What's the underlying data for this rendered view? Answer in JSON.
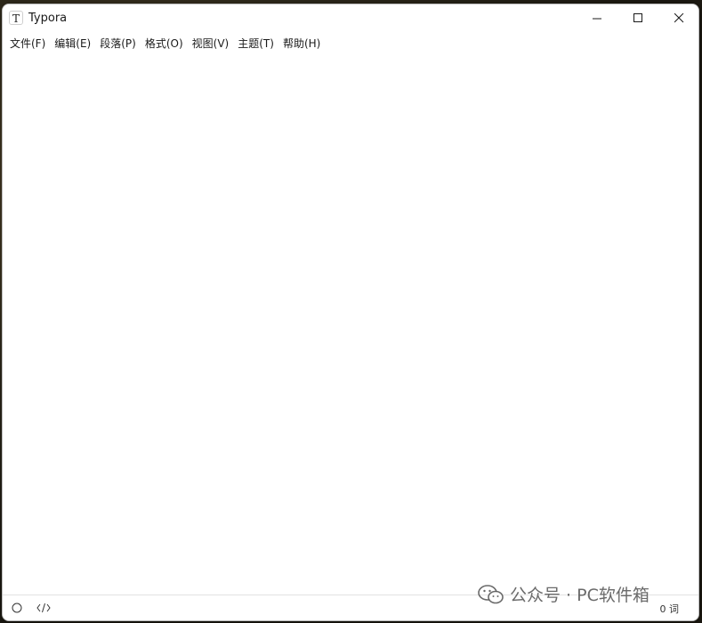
{
  "window": {
    "title": "Typora",
    "icon_letter": "T"
  },
  "menubar": {
    "items": [
      {
        "label": "文件(F)"
      },
      {
        "label": "编辑(E)"
      },
      {
        "label": "段落(P)"
      },
      {
        "label": "格式(O)"
      },
      {
        "label": "视图(V)"
      },
      {
        "label": "主题(T)"
      },
      {
        "label": "帮助(H)"
      }
    ]
  },
  "statusbar": {
    "left_icons": [
      "outline-circle-icon",
      "source-code-icon"
    ],
    "word_count": "0 词"
  },
  "watermark": {
    "text": "公众号 · PC软件箱"
  },
  "colors": {
    "window_bg": "#ffffff",
    "text": "#1a1a1a",
    "desktop": "#2f2a1c"
  }
}
